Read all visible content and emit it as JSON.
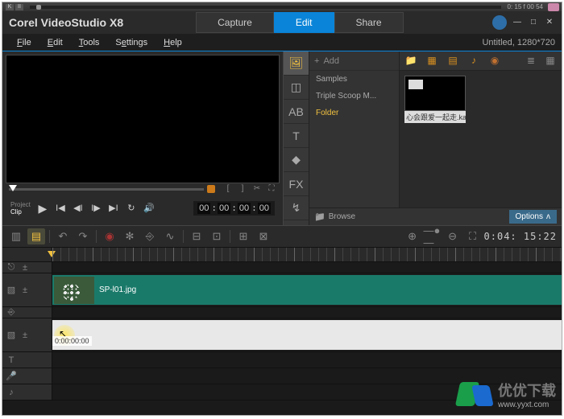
{
  "topbar": {
    "time": "0: 15 f 00 54"
  },
  "app": {
    "title": "Corel VideoStudio X8"
  },
  "mainTabs": {
    "capture": "Capture",
    "edit": "Edit",
    "share": "Share",
    "active": "edit"
  },
  "menu": {
    "file": "File",
    "edit": "Edit",
    "tools": "Tools",
    "settings": "Settings",
    "help": "Help"
  },
  "project": {
    "info": "Untitled, 1280*720"
  },
  "preview": {
    "modeProject": "Project",
    "modeClip": "Clip",
    "timecode": {
      "h": "00",
      "m": "00",
      "s": "00",
      "f": "00"
    }
  },
  "library": {
    "addLabel": "Add",
    "folders": {
      "samples": "Samples",
      "triple": "Triple Scoop M...",
      "folder": "Folder"
    },
    "thumbCaption": "心会跟爱一起走.kax",
    "browse": "Browse",
    "options": "Options"
  },
  "timelineToolbar": {
    "endTime": "0:04: 15:22"
  },
  "tracks": {
    "videoClip": "SP-l01.jpg",
    "blankTc": "0:00:00:00"
  },
  "watermark": {
    "cn": "优优下载",
    "url": "www.yyxt.com"
  }
}
